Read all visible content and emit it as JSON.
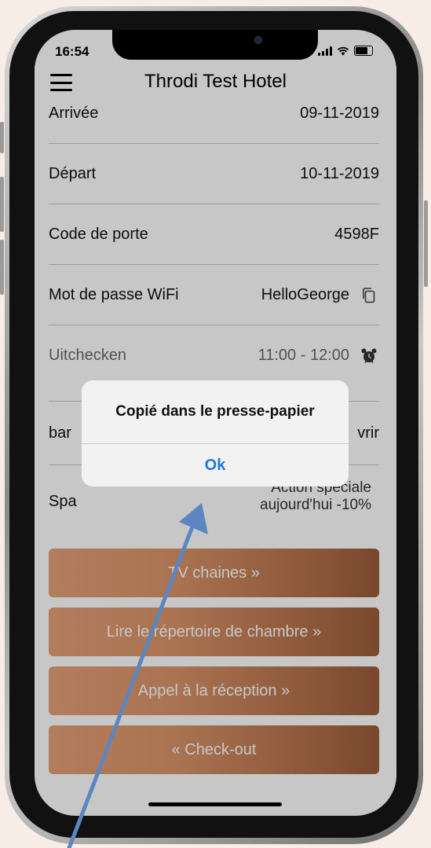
{
  "status_bar": {
    "time": "16:54"
  },
  "header": {
    "title": "Throdi Test Hotel"
  },
  "booking": {
    "rows": [
      {
        "label": "Arrivée",
        "value": "09-11-2019"
      },
      {
        "label": "Départ",
        "value": "10-11-2019"
      },
      {
        "label": "Code de porte",
        "value": "4598F"
      },
      {
        "label": "Mot de passe WiFi",
        "value": "HelloGeorge",
        "icon": "copy-icon"
      },
      {
        "label": "Uitchecken",
        "value": "11:00 - 12:00",
        "icon": "alarm-clock-icon"
      },
      {
        "label": "bar",
        "value": "vrir"
      },
      {
        "label": "Spa",
        "value_line1": "Action speciale",
        "value_line2": "aujourd'hui -10%"
      }
    ]
  },
  "buttons": {
    "tv": "TV chaines »",
    "directory": "Lire le répertoire de chambre »",
    "reception": "Appel à la réception »",
    "checkout": "« Check-out"
  },
  "alert": {
    "message": "Copié dans le presse-papier",
    "ok_label": "Ok"
  },
  "colors": {
    "button_gradient_start": "#e6a178",
    "button_gradient_end": "#9a5c3a",
    "alert_button": "#1f7ae0",
    "annotation_arrow": "#5b86c0",
    "background": "#f7ece6"
  }
}
